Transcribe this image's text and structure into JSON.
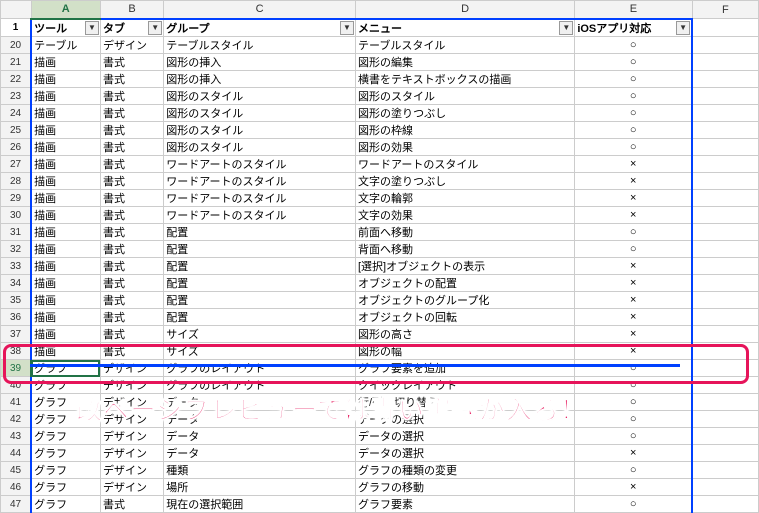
{
  "columns": [
    "A",
    "B",
    "C",
    "D",
    "E",
    "F"
  ],
  "selectedCol": "A",
  "header": {
    "row": 1,
    "cells": [
      "ツール",
      "タブ",
      "グループ",
      "メニュー",
      "iOSアプリ対応",
      ""
    ]
  },
  "rows": [
    {
      "n": 20,
      "c": [
        "テーブル",
        "デザイン",
        "テーブルスタイル",
        "テーブルスタイル",
        "○",
        ""
      ]
    },
    {
      "n": 21,
      "c": [
        "描画",
        "書式",
        "図形の挿入",
        "図形の編集",
        "○",
        ""
      ]
    },
    {
      "n": 22,
      "c": [
        "描画",
        "書式",
        "図形の挿入",
        "横書をテキストボックスの描画",
        "○",
        ""
      ]
    },
    {
      "n": 23,
      "c": [
        "描画",
        "書式",
        "図形のスタイル",
        "図形のスタイル",
        "○",
        ""
      ]
    },
    {
      "n": 24,
      "c": [
        "描画",
        "書式",
        "図形のスタイル",
        "図形の塗りつぶし",
        "○",
        ""
      ]
    },
    {
      "n": 25,
      "c": [
        "描画",
        "書式",
        "図形のスタイル",
        "図形の枠線",
        "○",
        ""
      ]
    },
    {
      "n": 26,
      "c": [
        "描画",
        "書式",
        "図形のスタイル",
        "図形の効果",
        "○",
        ""
      ]
    },
    {
      "n": 27,
      "c": [
        "描画",
        "書式",
        "ワードアートのスタイル",
        "ワードアートのスタイル",
        "×",
        ""
      ]
    },
    {
      "n": 28,
      "c": [
        "描画",
        "書式",
        "ワードアートのスタイル",
        "文字の塗りつぶし",
        "×",
        ""
      ]
    },
    {
      "n": 29,
      "c": [
        "描画",
        "書式",
        "ワードアートのスタイル",
        "文字の輪郭",
        "×",
        ""
      ]
    },
    {
      "n": 30,
      "c": [
        "描画",
        "書式",
        "ワードアートのスタイル",
        "文字の効果",
        "×",
        ""
      ]
    },
    {
      "n": 31,
      "c": [
        "描画",
        "書式",
        "配置",
        "前面へ移動",
        "○",
        ""
      ]
    },
    {
      "n": 32,
      "c": [
        "描画",
        "書式",
        "配置",
        "背面へ移動",
        "○",
        ""
      ]
    },
    {
      "n": 33,
      "c": [
        "描画",
        "書式",
        "配置",
        "[選択]オブジェクトの表示",
        "×",
        ""
      ]
    },
    {
      "n": 34,
      "c": [
        "描画",
        "書式",
        "配置",
        "オブジェクトの配置",
        "×",
        ""
      ]
    },
    {
      "n": 35,
      "c": [
        "描画",
        "書式",
        "配置",
        "オブジェクトのグループ化",
        "×",
        ""
      ]
    },
    {
      "n": 36,
      "c": [
        "描画",
        "書式",
        "配置",
        "オブジェクトの回転",
        "×",
        ""
      ]
    },
    {
      "n": 37,
      "c": [
        "描画",
        "書式",
        "サイズ",
        "図形の高さ",
        "×",
        ""
      ]
    },
    {
      "n": 38,
      "c": [
        "描画",
        "書式",
        "サイズ",
        "図形の幅",
        "×",
        ""
      ]
    },
    {
      "n": 39,
      "c": [
        "グラフ",
        "デザイン",
        "グラフのレイアウト",
        "グラフ要素を追加",
        "○",
        ""
      ],
      "sel": true
    },
    {
      "n": 40,
      "c": [
        "グラフ",
        "デザイン",
        "グラフのレイアウト",
        "クイックレイアウト",
        "○",
        ""
      ]
    },
    {
      "n": 41,
      "c": [
        "グラフ",
        "デザイン",
        "データ",
        "行/列の切り替え",
        "○",
        ""
      ]
    },
    {
      "n": 42,
      "c": [
        "グラフ",
        "デザイン",
        "データ",
        "データの選択",
        "○",
        ""
      ]
    },
    {
      "n": 43,
      "c": [
        "グラフ",
        "デザイン",
        "データ",
        "データの選択",
        "○",
        ""
      ]
    },
    {
      "n": 44,
      "c": [
        "グラフ",
        "デザイン",
        "データ",
        "データの選択",
        "×",
        ""
      ]
    },
    {
      "n": 45,
      "c": [
        "グラフ",
        "デザイン",
        "種類",
        "グラフの種類の変更",
        "○",
        ""
      ]
    },
    {
      "n": 46,
      "c": [
        "グラフ",
        "デザイン",
        "場所",
        "グラフの移動",
        "×",
        ""
      ]
    },
    {
      "n": 47,
      "c": [
        "グラフ",
        "書式",
        "現在の選択範囲",
        "グラフ要素",
        "○",
        ""
      ]
    }
  ],
  "annotation": "改ページプレビューでは青い実線が入る！",
  "dropdownGlyph": "▼"
}
